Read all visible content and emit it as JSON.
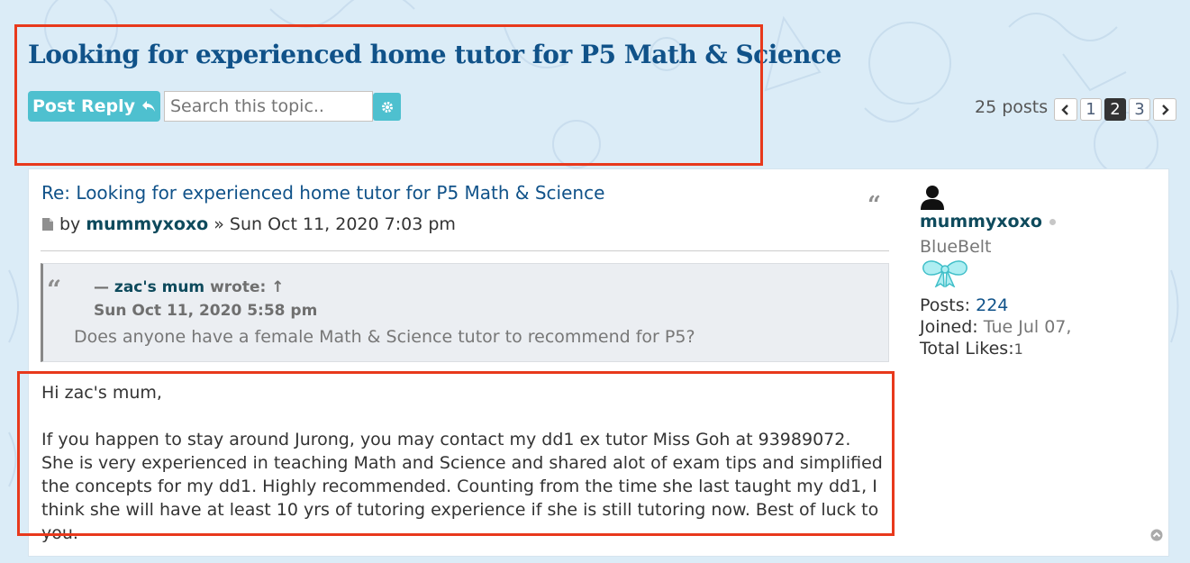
{
  "topic": {
    "title": "Looking for experienced home tutor for P5 Math & Science",
    "post_reply_label": "Post Reply",
    "search_placeholder": "Search this topic..",
    "post_count": "25 posts",
    "pages": [
      "1",
      "2",
      "3"
    ],
    "current_page": "2"
  },
  "post": {
    "subject": "Re: Looking for experienced home tutor for P5 Math & Science",
    "by_label": "by",
    "author": "mummyxoxo",
    "date": "» Sun Oct 11, 2020 7:03 pm",
    "quote": {
      "prefix": "—",
      "author": "zac's mum",
      "wrote_label": "wrote: ↑",
      "date": "Sun Oct 11, 2020 5:58 pm",
      "text": "Does anyone have a female Math & Science tutor to recommend for P5?"
    },
    "body": [
      "Hi zac's mum,",
      "If you happen to stay around Jurong, you may contact my dd1 ex tutor Miss Goh at 93989072. She is very experienced in teaching Math and Science and shared alot of exam tips and simplified the concepts for my dd1. Highly recommended. Counting from the time she last taught my dd1, I think she will have at least 10 yrs of tutoring experience if she is still tutoring now. Best of luck to you."
    ]
  },
  "profile": {
    "username": "mummyxoxo",
    "rank": "BlueBelt",
    "posts_label": "Posts:",
    "posts_value": "224",
    "joined_label": "Joined:",
    "joined_value": "Tue Jul 07,",
    "likes_label": "Total Likes:",
    "likes_value": "1"
  },
  "icons": {
    "reply": "reply-icon",
    "search_options": "gear-icon",
    "post": "document-icon",
    "quote": "quote-icon",
    "avatar": "user-icon",
    "rank": "ribbon-icon",
    "back_to_top": "arrow-up-circle-icon"
  },
  "colors": {
    "accent": "#4ec0cf",
    "link": "#105289",
    "highlight": "#e8391c",
    "background": "#dbecf7"
  }
}
